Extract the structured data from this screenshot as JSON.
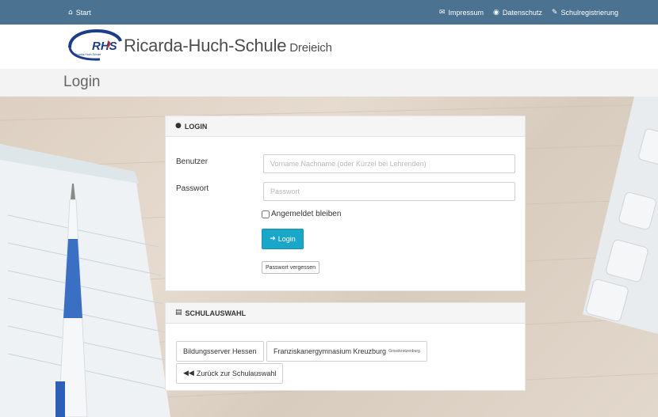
{
  "topnav": {
    "start": "Start",
    "links": [
      {
        "label": "Impressum",
        "icon": "envelope-icon"
      },
      {
        "label": "Datenschutz",
        "icon": "eye-icon"
      },
      {
        "label": "Schulregistrierung",
        "icon": "wrench-icon"
      }
    ],
    "bg_color": "#4b7291"
  },
  "header": {
    "logo_text": "RHS",
    "logo_subtext": "Ricarda-Huch-Schule",
    "school_name": "Ricarda-Huch-Schule",
    "city": "Dreieich"
  },
  "page": {
    "title": "Login"
  },
  "login_panel": {
    "heading": "LOGIN",
    "user_label": "Benutzer",
    "user_placeholder": "Vorname.Nachname (oder Kürzel bei Lehrenden)",
    "password_label": "Passwort",
    "password_placeholder": "Passwort",
    "remember_label": "Angemeldet bleiben",
    "login_button": "Login",
    "forgot_button": "Passwort vergessen",
    "accent": "#1aa6c9"
  },
  "schul_panel": {
    "heading": "SCHULAUSWAHL",
    "schools": [
      {
        "name": "Bildungsserver Hessen",
        "location": ""
      },
      {
        "name": "Franziskanergymnasium Kreuzburg",
        "location": "Grosskrotzenburg"
      }
    ],
    "back_button": "Zurück zur Schulauswahl"
  }
}
